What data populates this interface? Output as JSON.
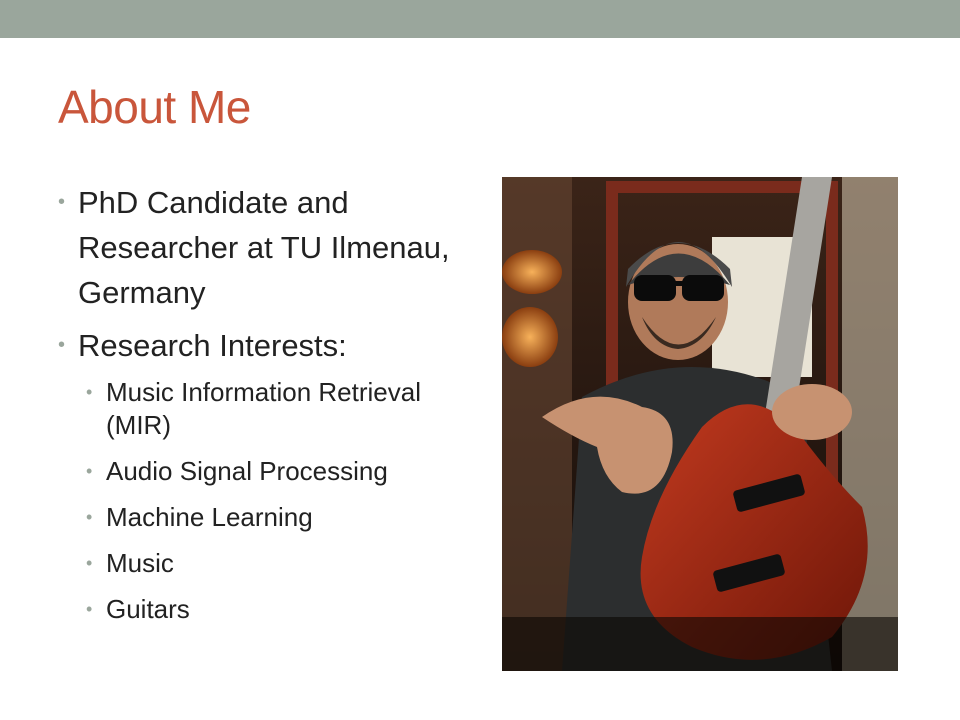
{
  "slide": {
    "title": "About Me",
    "bullets": [
      {
        "text": "PhD Candidate and Researcher at TU Ilmenau, Germany"
      },
      {
        "text": "Research Interests:"
      }
    ],
    "sub_bullets": [
      "Music Information Retrieval (MIR)",
      "Audio Signal Processing",
      "Machine Learning",
      "Music",
      "Guitars"
    ]
  },
  "colors": {
    "header_bar": "#9aa69c",
    "title": "#c9563b",
    "text": "#222222",
    "bullet": "#9aa69c"
  },
  "photo": {
    "subject": "man in beanie and sunglasses holding red electric guitar, pointing at camera"
  }
}
